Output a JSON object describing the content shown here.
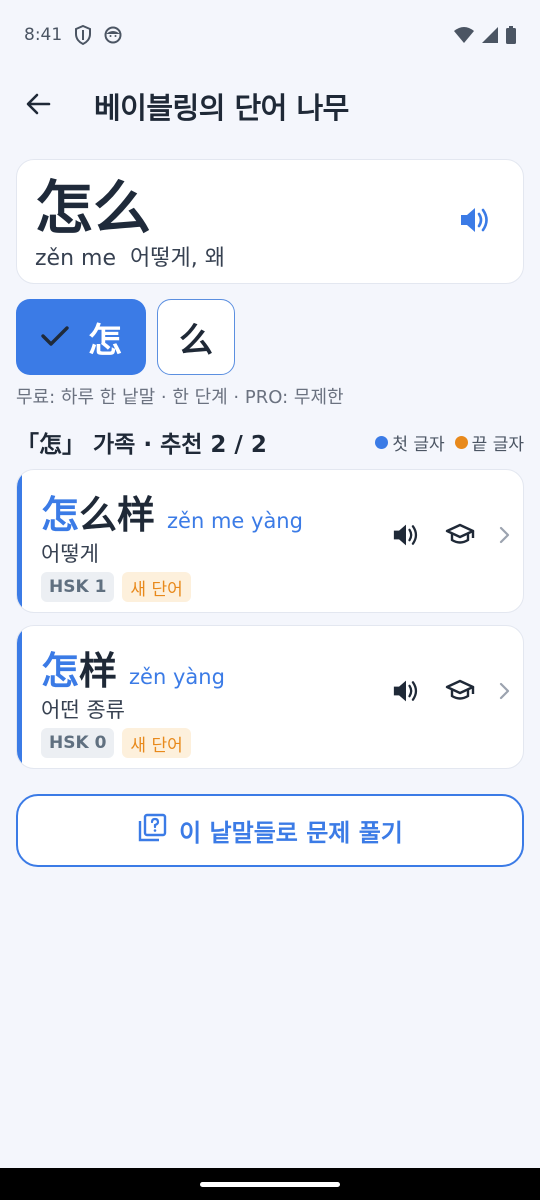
{
  "status_bar": {
    "time": "8:41",
    "left_icons": [
      "shield-icon",
      "face-icon"
    ],
    "right_icons": [
      "wifi-icon",
      "signal-icon",
      "battery-icon"
    ]
  },
  "app_bar": {
    "back_icon": "arrow-left-icon",
    "title": "베이블링의 단어 나무"
  },
  "hero": {
    "character": "怎么",
    "pinyin": "zěn me",
    "meaning": "어떻게, 왜",
    "speaker_icon": "speaker-icon"
  },
  "chips": [
    {
      "label": "怎",
      "selected": true,
      "icon": "check-icon"
    },
    {
      "label": "么",
      "selected": false
    }
  ],
  "quota_text": "무료: 하루 한 낱말 · 한 단계  ·  PRO: 무제한",
  "section": {
    "title": "「怎」 가족 · 추천 2 / 2",
    "legend_first": "첫 글자",
    "legend_last": "끝 글자",
    "legend_first_color": "#3b7be6",
    "legend_last_color": "#e8891b"
  },
  "words": [
    {
      "hanzi_first": "怎",
      "hanzi_rest": "么样",
      "pinyin": "zěn me yàng",
      "meaning": "어떻게",
      "hsk": "HSK 1",
      "new_label": "새 단어"
    },
    {
      "hanzi_first": "怎",
      "hanzi_rest": "样",
      "pinyin": "zěn yàng",
      "meaning": "어떤 종류",
      "hsk": "HSK 0",
      "new_label": "새 단어"
    }
  ],
  "quiz_button": {
    "label": "이 낱말들로 문제 풀기",
    "icon": "quiz-icon"
  },
  "colors": {
    "accent": "#3b7be6",
    "orange": "#e8891b",
    "background": "#f4f6fc"
  }
}
